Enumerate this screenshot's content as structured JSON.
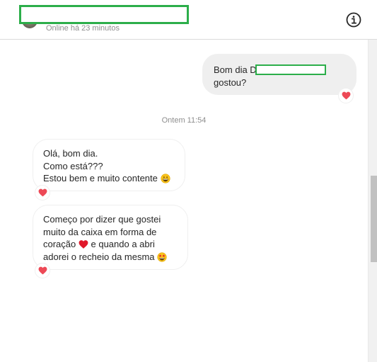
{
  "header": {
    "status": "Online há 23 minutos",
    "info_icon": "info-icon"
  },
  "messages": {
    "outgoing": {
      "line1": "Bom dia D",
      "line2": "gostou?",
      "reaction_icon": "heart-icon"
    },
    "timestamp": "Ontem 11:54",
    "incoming1": {
      "line1": "Olá, bom dia.",
      "line2": "Como está???",
      "line3": "Estou bem e muito contente",
      "emoji_icon": "grinning-face-icon",
      "reaction_icon": "heart-icon"
    },
    "incoming2": {
      "line1": "Começo por dizer que gostei",
      "line2": "muito da caixa em forma de",
      "line3a": "coração",
      "line3b": "e quando a abri",
      "line4": "adorei o recheio da mesma",
      "heart_emoji_icon": "red-heart-icon",
      "star_eyes_icon": "star-struck-icon",
      "reaction_icon": "heart-icon"
    }
  },
  "colors": {
    "redaction": "#2cae4a",
    "heart": "#ed4956",
    "bubble_out": "#efefef"
  }
}
